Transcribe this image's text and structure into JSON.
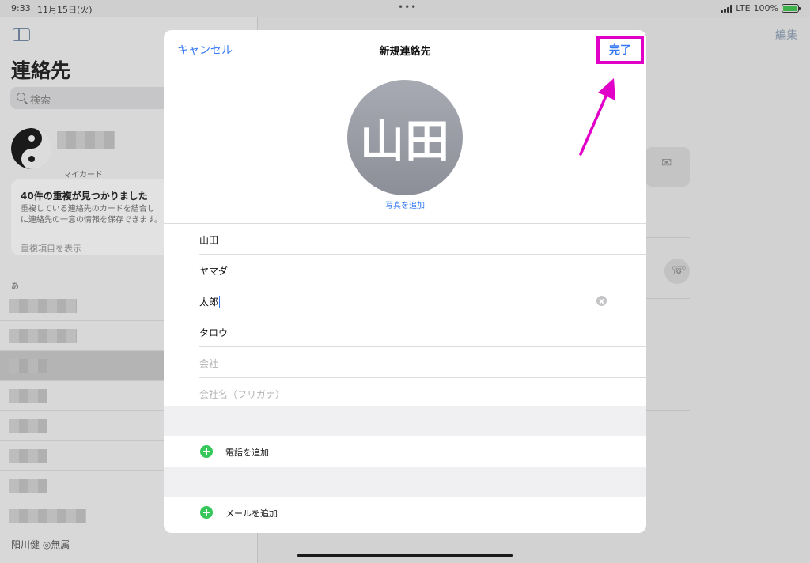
{
  "status_bar": {
    "time": "9:33",
    "date": "11月15日(火)",
    "dots": "•••",
    "carrier": "LTE",
    "battery": "100%",
    "battery_level": 1.0
  },
  "sidebar": {
    "title": "連絡先",
    "search_placeholder": "検索",
    "my_card_label": "マイカード",
    "duplicates": {
      "title": "40件の重複が見つかりました",
      "description": "重複している連絡先のカードを結合し\nに連絡先の一意の情報を保存できます。",
      "link": "重複項目を表示"
    },
    "section_letter": "あ",
    "partial_contact": "阳川健 ◎無属"
  },
  "detail": {
    "edit_label": "編集"
  },
  "modal": {
    "cancel_label": "キャンセル",
    "title": "新規連絡先",
    "done_label": "完了",
    "avatar_initials": "山田",
    "add_photo_label": "写真を追加",
    "fields": [
      {
        "value": "山田",
        "placeholder": ""
      },
      {
        "value": "ヤマダ",
        "placeholder": ""
      },
      {
        "value": "太郎",
        "placeholder": ""
      },
      {
        "value": "タロウ",
        "placeholder": ""
      },
      {
        "value": "",
        "placeholder": "会社"
      },
      {
        "value": "",
        "placeholder": "会社名（フリガナ）"
      }
    ],
    "add_phone_label": "電話を追加",
    "add_email_label": "メールを追加"
  },
  "colors": {
    "accent": "#3478f6",
    "highlight": "#e000c8",
    "add_green": "#35c759"
  }
}
